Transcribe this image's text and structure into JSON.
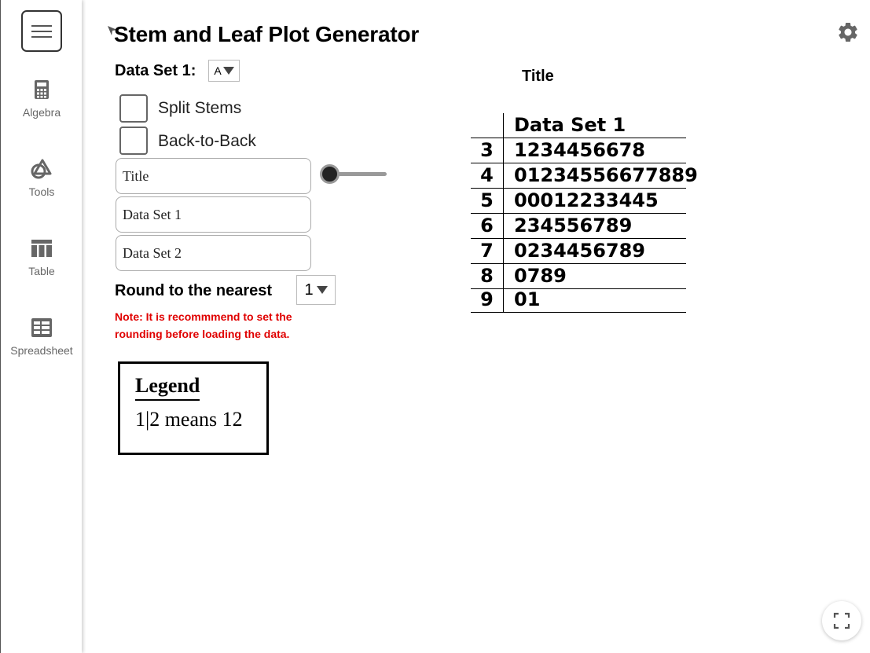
{
  "sidebar": {
    "items": [
      {
        "label": "Algebra",
        "icon": "calculator-icon"
      },
      {
        "label": "Tools",
        "icon": "shapes-icon"
      },
      {
        "label": "Table",
        "icon": "table-icon"
      },
      {
        "label": "Spreadsheet",
        "icon": "spreadsheet-icon"
      }
    ]
  },
  "header": {
    "title": "Stem and Leaf Plot Generator"
  },
  "controls": {
    "data_set_label": "Data Set 1:",
    "data_set_selected": "A",
    "split_stems_label": "Split Stems",
    "back_to_back_label": "Back-to-Back",
    "inputs": {
      "title": "Title",
      "data_set_1": "Data Set 1",
      "data_set_2": "Data Set 2"
    },
    "round_label": "Round to the nearest",
    "round_selected": "1",
    "note": "Note: It is recommmend to set the rounding before loading the data."
  },
  "legend": {
    "heading": "Legend",
    "text": "1|2 means 12"
  },
  "plot": {
    "title": "Title",
    "header": "Data Set 1",
    "rows": [
      {
        "stem": "3",
        "leaves": "1234456678"
      },
      {
        "stem": "4",
        "leaves": "01234556677889"
      },
      {
        "stem": "5",
        "leaves": "00012233445"
      },
      {
        "stem": "6",
        "leaves": "234556789"
      },
      {
        "stem": "7",
        "leaves": "0234456789"
      },
      {
        "stem": "8",
        "leaves": "0789"
      },
      {
        "stem": "9",
        "leaves": "01"
      }
    ]
  },
  "colors": {
    "note": "#e00000",
    "icon": "#666666"
  }
}
